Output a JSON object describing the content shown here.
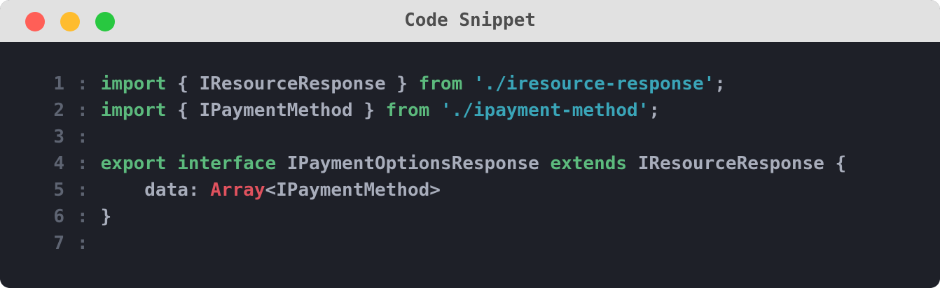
{
  "window": {
    "title": "Code Snippet",
    "buttons": {
      "close_color": "#ff5f57",
      "minimize_color": "#febc2e",
      "maximize_color": "#28c840"
    }
  },
  "theme": {
    "keyword": "#5cba7d",
    "string": "#3aa5b8",
    "plain": "#a8adbb",
    "type_builtin": "#e0525e",
    "line_number": "#5e6472",
    "background": "#1e2028"
  },
  "code": {
    "separator": ":",
    "lines": [
      {
        "number": "1",
        "tokens": [
          {
            "text": "import",
            "kind": "keyword"
          },
          {
            "text": " { IResourceResponse } ",
            "kind": "plain"
          },
          {
            "text": "from",
            "kind": "keyword"
          },
          {
            "text": " ",
            "kind": "plain"
          },
          {
            "text": "'./iresource-response'",
            "kind": "string"
          },
          {
            "text": ";",
            "kind": "plain"
          }
        ]
      },
      {
        "number": "2",
        "tokens": [
          {
            "text": "import",
            "kind": "keyword"
          },
          {
            "text": " { IPaymentMethod } ",
            "kind": "plain"
          },
          {
            "text": "from",
            "kind": "keyword"
          },
          {
            "text": " ",
            "kind": "plain"
          },
          {
            "text": "'./ipayment-method'",
            "kind": "string"
          },
          {
            "text": ";",
            "kind": "plain"
          }
        ]
      },
      {
        "number": "3",
        "tokens": []
      },
      {
        "number": "4",
        "tokens": [
          {
            "text": "export",
            "kind": "keyword"
          },
          {
            "text": " ",
            "kind": "plain"
          },
          {
            "text": "interface",
            "kind": "keyword"
          },
          {
            "text": " IPaymentOptionsResponse ",
            "kind": "plain"
          },
          {
            "text": "extends",
            "kind": "keyword"
          },
          {
            "text": " IResourceResponse {",
            "kind": "plain"
          }
        ]
      },
      {
        "number": "5",
        "tokens": [
          {
            "text": "    data: ",
            "kind": "plain"
          },
          {
            "text": "Array",
            "kind": "type_builtin"
          },
          {
            "text": "<IPaymentMethod>",
            "kind": "plain"
          }
        ]
      },
      {
        "number": "6",
        "tokens": [
          {
            "text": "}",
            "kind": "plain"
          }
        ]
      },
      {
        "number": "7",
        "tokens": []
      }
    ]
  }
}
